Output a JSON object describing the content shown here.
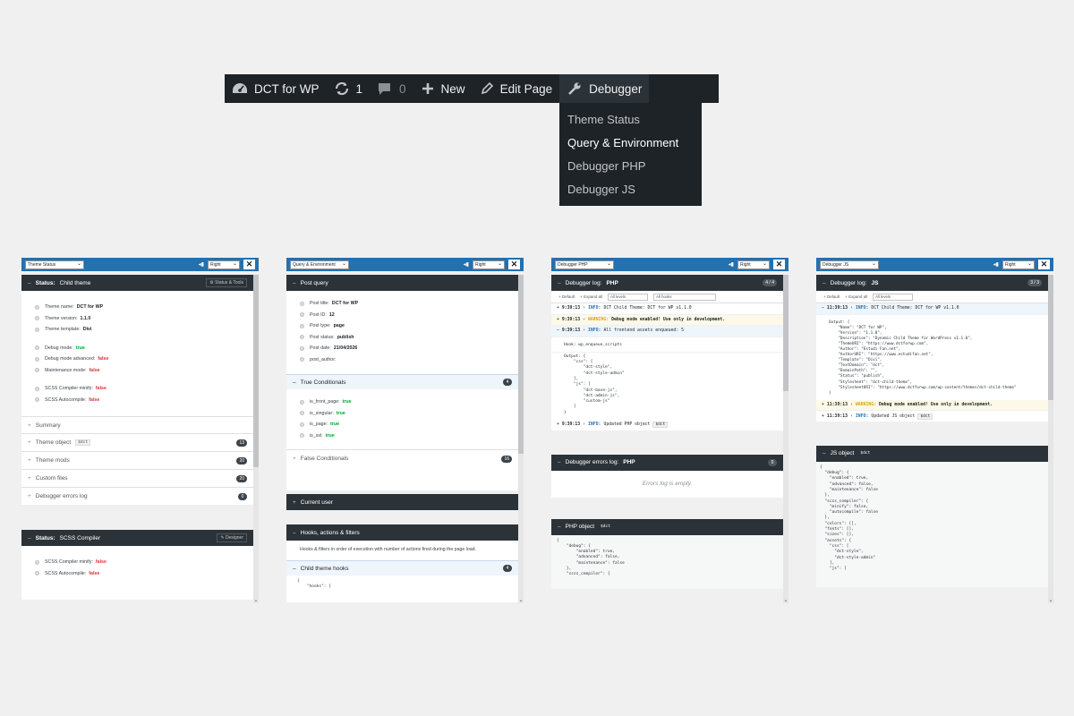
{
  "admin_bar": {
    "site_name": "DCT for WP",
    "updates_count": "1",
    "comments_count": "0",
    "new_label": "New",
    "edit_label": "Edit Page",
    "debugger_label": "Debugger",
    "dropdown": [
      "Theme Status",
      "Query & Environment",
      "Debugger PHP",
      "Debugger JS"
    ]
  },
  "panels": {
    "p1": {
      "select": "Theme Status",
      "position": "Right",
      "status_title_prefix": "Status:",
      "status_title": "Child theme",
      "status_button": "Status & Tools",
      "rows": {
        "name_k": "Theme name:",
        "name_v": "DCT for WP",
        "ver_k": "Theme version:",
        "ver_v": "1.1.0",
        "tpl_k": "Theme template:",
        "tpl_v": "Divi",
        "dbg_k": "Debug mode:",
        "dbg_v": "true",
        "adv_k": "Debug mode advanced:",
        "adv_v": "false",
        "mnt_k": "Maintenance mode:",
        "mnt_v": "false",
        "min_k": "SCSS Compiler minify:",
        "min_v": "false",
        "auto_k": "SCSS Autocompile:",
        "auto_v": "false"
      },
      "summary": "Summary",
      "theme_object": "Theme object",
      "theme_object_tag": "$dct",
      "theme_object_count": "13",
      "theme_mods": "Theme mods",
      "theme_mods_count": "20",
      "custom_files": "Custom files",
      "custom_files_count": "20",
      "errors_log": "Debugger errors log",
      "errors_log_count": "0",
      "scss_title_prefix": "Status:",
      "scss_title": "SCSS Compiler",
      "scss_button": "Designer",
      "scss_min_k": "SCSS Compiler minify:",
      "scss_min_v": "false",
      "scss_auto_k": "SCSS Autocompile:",
      "scss_auto_v": "false"
    },
    "p2": {
      "select": "Query & Environment",
      "position": "Right",
      "post_query": "Post query",
      "rows": {
        "title_k": "Post title:",
        "title_v": "DCT for WP",
        "id_k": "Post ID:",
        "id_v": "12",
        "type_k": "Post type:",
        "type_v": "page",
        "status_k": "Post status:",
        "status_v": "publish",
        "date_k": "Post date:",
        "date_v": "21/04/2026",
        "author_k": "post_author:"
      },
      "true_cond": "True Conditionals",
      "true_count": "4",
      "cond": {
        "fp_k": "is_front_page:",
        "fp_v": "true",
        "sg_k": "is_singular:",
        "sg_v": "true",
        "pg_k": "is_page:",
        "pg_v": "true",
        "ssl_k": "is_ssl:",
        "ssl_v": "true"
      },
      "false_cond": "False Conditionals",
      "false_count": "16",
      "current_user": "Current user",
      "hooks": "Hooks, actions & filters",
      "hooks_desc": "Hooks & filters in order of execution with number of actions fired during the page load.",
      "child_hooks": "Child theme hooks",
      "child_hooks_count": "4",
      "hooks_code": "{\n    \"hooks\": ["
    },
    "p3": {
      "select": "Debugger PHP",
      "position": "Right",
      "title": "Debugger log:",
      "title_b": "PHP",
      "count": "4 / 4",
      "toolbar": {
        "default": "Default",
        "expand": "Expand all",
        "levels": "All levels",
        "hooks": "All hooks"
      },
      "log1": {
        "time": "9:39:13",
        "level": "INFO:",
        "msg": "DCT Child Theme: DCT for WP v1.1.0"
      },
      "log2": {
        "time": "9:39:13",
        "level": "WARNING:",
        "msg": "Debug mode enabled! Use only in development."
      },
      "log3": {
        "time": "9:39:13",
        "level": "INFO:",
        "msg": "All frontend assets enqueued: 5"
      },
      "hook_line": "Hook: wp_enqueue_scripts",
      "output": "Output: {\n    \"css\": [\n        \"dct-style\",\n        \"dct-style-admin\"\n    ],\n    \"js\": [\n        \"dct-base-js\",\n        \"dct-admin-js\",\n        \"custom-js\"\n    ]\n}",
      "log4": {
        "time": "9:39:13",
        "level": "INFO:",
        "msg": "Updated PHP object",
        "tag": "$dct"
      },
      "errors_title": "Debugger errors log:",
      "errors_title_b": "PHP",
      "errors_count": "0",
      "errors_empty": "Errors log is empty.",
      "php_object": "PHP object",
      "php_object_tag": "$dct",
      "php_code": "{\n    \"debug\": {\n        \"enabled\": true,\n        \"advanced\": false,\n        \"maintenance\": false\n    },\n    \"scss_compiler\": {"
    },
    "p4": {
      "select": "Debugger JS",
      "position": "Right",
      "title": "Debugger log:",
      "title_b": "JS",
      "count": "3 / 3",
      "toolbar": {
        "default": "Default",
        "expand": "Expand all",
        "levels": "All levels"
      },
      "log1": {
        "time": "11:39:13",
        "level": "INFO:",
        "msg": "DCT Child Theme: DCT for WP v1.1.0"
      },
      "output": "Output: {\n    \"Name\": \"DCT for WP\",\n    \"Version\": \"1.1.0\",\n    \"Description\": \"Dynamic Child Theme for WordPress v1.1.0\",\n    \"ThemeURI\": \"https://www.dctforwp.com\",\n    \"Author\": \"Estudi Fan.net\",\n    \"AuthorURI\": \"https://www.estudifan.net\",\n    \"Template\": \"Divi\",\n    \"TextDomain\": \"dct\",\n    \"DomainPath\": \"\",\n    \"Status\": \"publish\",\n    \"Stylesheet\": \"dct-child-theme\",\n    \"StylesheetURI\": \"https://www.dctforwp.com/wp-content/themes/dct-child-theme\"\n}",
      "log2": {
        "time": "11:39:13",
        "level": "WARNING:",
        "msg": "Debug mode enabled! Use only in development."
      },
      "log3": {
        "time": "11:39:13",
        "level": "INFO:",
        "msg": "Updated JS object",
        "tag": "$dct"
      },
      "js_object": "JS object",
      "js_object_tag": "$dct",
      "js_code": "{\n  \"debug\": {\n    \"enabled\": true,\n    \"advanced\": false,\n    \"maintenance\": false\n  },\n  \"scss_compiler\": {\n    \"minify\": false,\n    \"autocompile\": false\n  },\n  \"colors\": [],\n  \"fonts\": [],\n  \"sizes\": [],\n  \"assets\": {\n    \"css\": [\n      \"dct-style\",\n      \"dct-style-admin\"\n    ],\n    \"js\": ["
    }
  }
}
